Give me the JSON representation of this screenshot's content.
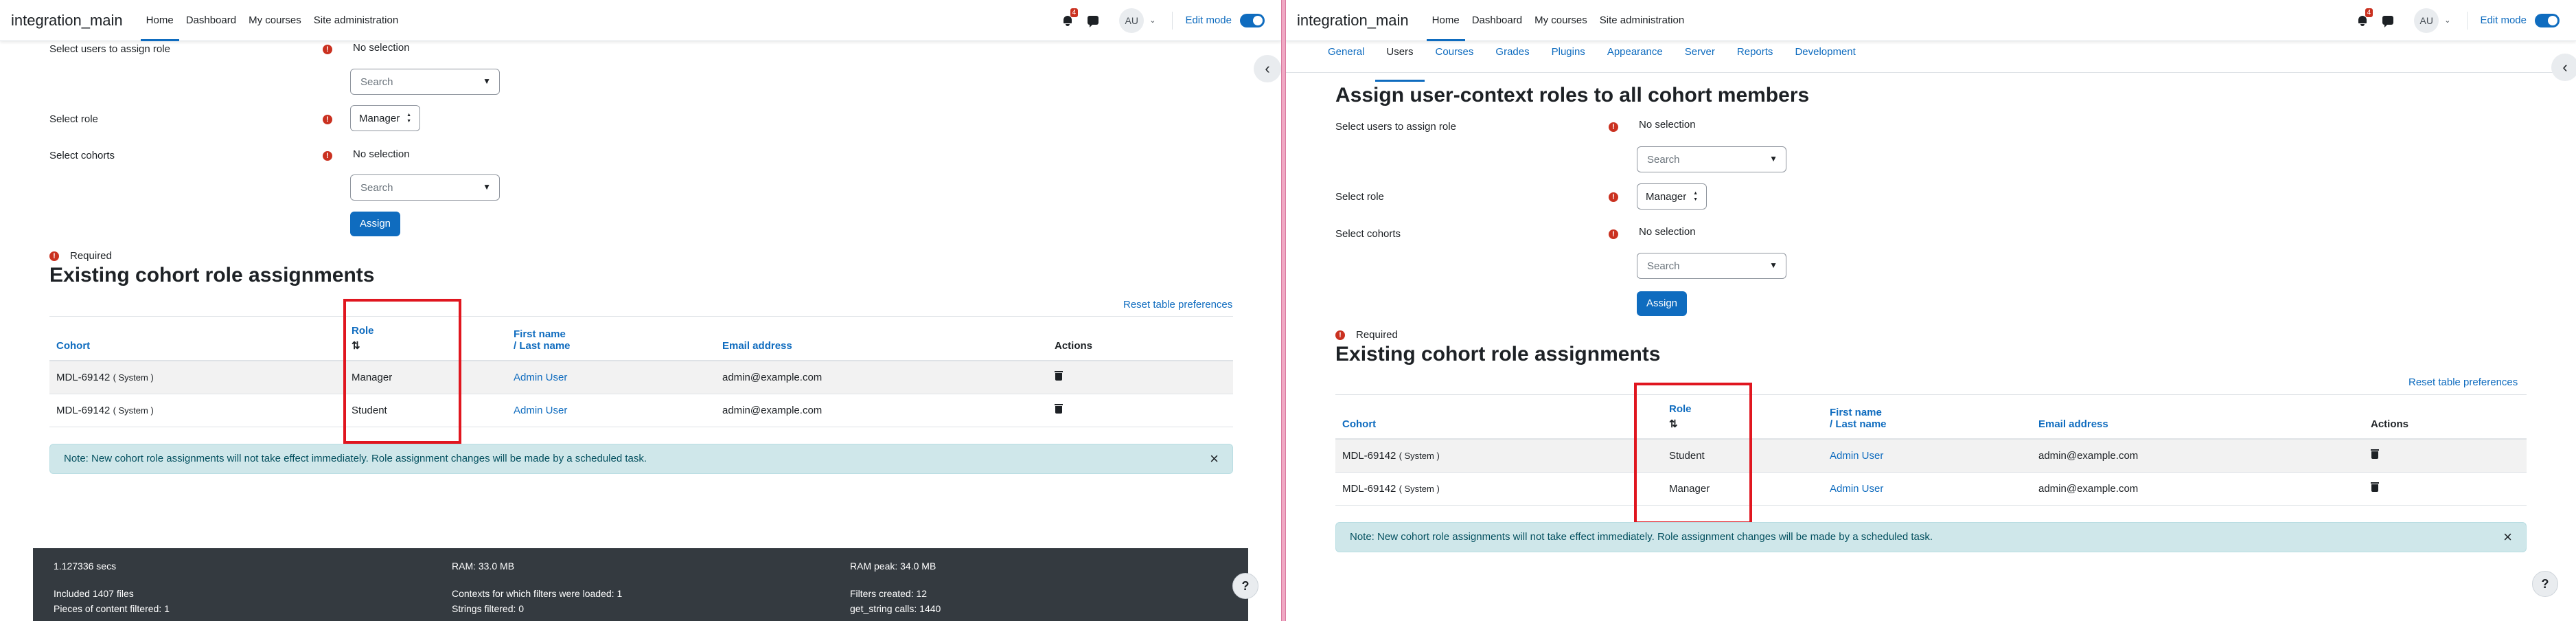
{
  "colors": {
    "primary": "#0f6cbf",
    "danger": "#ca3120",
    "highlight": "#e0161f",
    "info_bg": "#cfe7ea",
    "footer_bg": "#343a40"
  },
  "navbar": {
    "brand": "integration_main",
    "items": [
      "Home",
      "Dashboard",
      "My courses",
      "Site administration"
    ],
    "notification_count": "4",
    "avatar_initials": "AU",
    "edit_mode_label": "Edit mode"
  },
  "admin_tabs": [
    "General",
    "Users",
    "Courses",
    "Grades",
    "Plugins",
    "Appearance",
    "Server",
    "Reports",
    "Development"
  ],
  "page_heading": "Assign user-context roles to all cohort members",
  "form": {
    "users_label": "Select users to assign role",
    "users_value": "No selection",
    "search_placeholder": "Search",
    "role_label": "Select role",
    "role_value": "Manager",
    "cohorts_label": "Select cohorts",
    "cohorts_value": "No selection",
    "assign_button": "Assign",
    "required_icon": "!",
    "required_note": "Required"
  },
  "existing": {
    "heading": "Existing cohort role assignments",
    "reset_link": "Reset table preferences",
    "columns": {
      "cohort": "Cohort",
      "role": "Role",
      "first_name": "First name",
      "last_name": "/ Last name",
      "email": "Email address",
      "actions": "Actions"
    }
  },
  "left_rows": [
    {
      "cohort": "MDL-69142",
      "context": "( System )",
      "role": "Manager",
      "user": "Admin User",
      "email": "admin@example.com"
    },
    {
      "cohort": "MDL-69142",
      "context": "( System )",
      "role": "Student",
      "user": "Admin User",
      "email": "admin@example.com"
    }
  ],
  "right_rows": [
    {
      "cohort": "MDL-69142",
      "context": "( System )",
      "role": "Student",
      "user": "Admin User",
      "email": "admin@example.com"
    },
    {
      "cohort": "MDL-69142",
      "context": "( System )",
      "role": "Manager",
      "user": "Admin User",
      "email": "admin@example.com"
    }
  ],
  "notice": "Note: New cohort role assignments will not take effect immediately. Role assignment changes will be made by a scheduled task.",
  "footer": {
    "time": "1.127336 secs",
    "ram": "RAM: 33.0 MB",
    "ram_peak": "RAM peak: 34.0 MB",
    "files": "Included 1407 files",
    "contexts": "Contexts for which filters were loaded: 1",
    "filters": "Filters created: 12",
    "pieces": "Pieces of content filtered: 1",
    "strings": "Strings filtered: 0",
    "get_string": "get_string calls: 1440"
  },
  "icons": {
    "close": "×",
    "help": "?",
    "drawer": "‹",
    "caret": "▼",
    "sort": "⇅",
    "updown_up": "▲",
    "updown_down": "▼",
    "chevron": "⌄"
  }
}
